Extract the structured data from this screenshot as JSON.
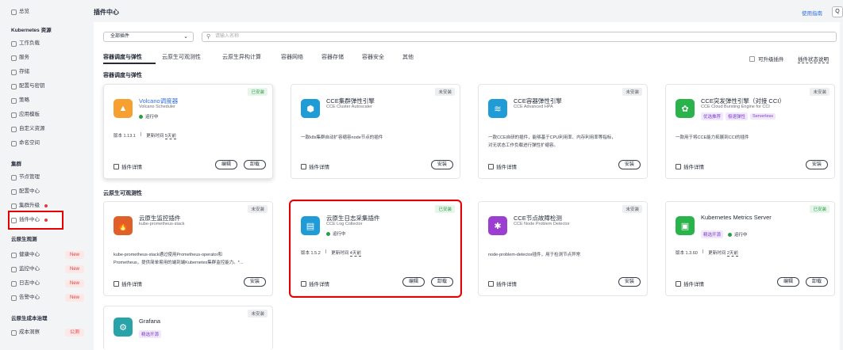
{
  "sidebar": {
    "overview": "总览",
    "k8s_group": "Kubernetes 资源",
    "workload": "工作负载",
    "service": "服务",
    "storage": "存储",
    "config": "配置与密钥",
    "policy": "策略",
    "template": "应用模板",
    "custom": "自定义资源",
    "namespace": "命名空间",
    "cluster_group": "集群",
    "node_mgmt": "节点管理",
    "config_center": "配置中心",
    "cluster_upgrade": "集群升级",
    "plugin_center": "插件中心",
    "observ_group": "云原生观测",
    "health": "健康中心",
    "monitor": "监控中心",
    "log": "日志中心",
    "alarm": "告警中心",
    "new_label": "New",
    "cost_group": "云原生成本治理",
    "cost": "成本洞察",
    "public_label": "公测"
  },
  "header": {
    "title": "插件中心",
    "help": "使用指南",
    "search_icon": "Q"
  },
  "filter": {
    "value": "全部插件",
    "search_placeholder": "请输入名称"
  },
  "tabs": [
    "容器调度与弹性",
    "云原生可观测性",
    "云原生异构计算",
    "容器网络",
    "容器存储",
    "容器安全",
    "其他"
  ],
  "upgradable": "可升级插件",
  "status_desc": "插件状态说明",
  "sections": {
    "sched": "容器调度与弹性",
    "observ": "云原生可观测性"
  },
  "labels": {
    "installed": "已安装",
    "not_installed": "未安装",
    "running": "运行中",
    "detail": "插件详情",
    "edit": "编辑",
    "uninstall": "卸载",
    "install": "安装",
    "version": "版本",
    "updated": "更新时间"
  },
  "cards": {
    "volcano": {
      "name": "Volcano调度器",
      "sub": "Volcano Scheduler",
      "version": "1.13.1",
      "updated": "5天前"
    },
    "autoscaler": {
      "name": "CCE集群弹性引擎",
      "sub": "CCE Cluster Autoscaler",
      "desc": "一款k8s集群自动扩容缩容node节点的插件"
    },
    "hpa": {
      "name": "CCE容器弹性引擎",
      "sub": "CCE Advanced HPA",
      "desc1": "一款CCE自研的插件，能够基于CPU利用率、内存利用率等指标，",
      "desc2": "对无状态工作负载进行弹性扩缩容。"
    },
    "bursting": {
      "name": "CCE突发弹性引擎（对接 CCI）",
      "sub": "CCE Cloud Bursting Engine for CCI",
      "tags": [
        "优选推荐",
        "极速弹性",
        "Serverless"
      ],
      "desc": "一款用于将CCE能力拓展到CCI的插件"
    },
    "prom": {
      "name": "云原生监控插件",
      "sub": "kube-prometheus-stack",
      "desc1": "kube-prometheus-stack通过使用Prometheus-operator和",
      "desc2": "Prometheus，提供简单易用的端到端Kubernetes集群监控能力。*..."
    },
    "log": {
      "name": "云原生日志采集插件",
      "sub": "CCE Log Collector",
      "version": "1.5.2",
      "updated": "4天前"
    },
    "npd": {
      "name": "CCE节点故障检测",
      "sub": "CCE Node Problem Detector",
      "desc": "node-problem-detector插件，用于检测节点异常"
    },
    "kms": {
      "name": "Kubernetes Metrics Server",
      "tag": "精选开源",
      "version": "1.3.60",
      "updated": "2天前"
    },
    "grafana": {
      "name": "Grafana",
      "tag": "精选开源"
    }
  }
}
